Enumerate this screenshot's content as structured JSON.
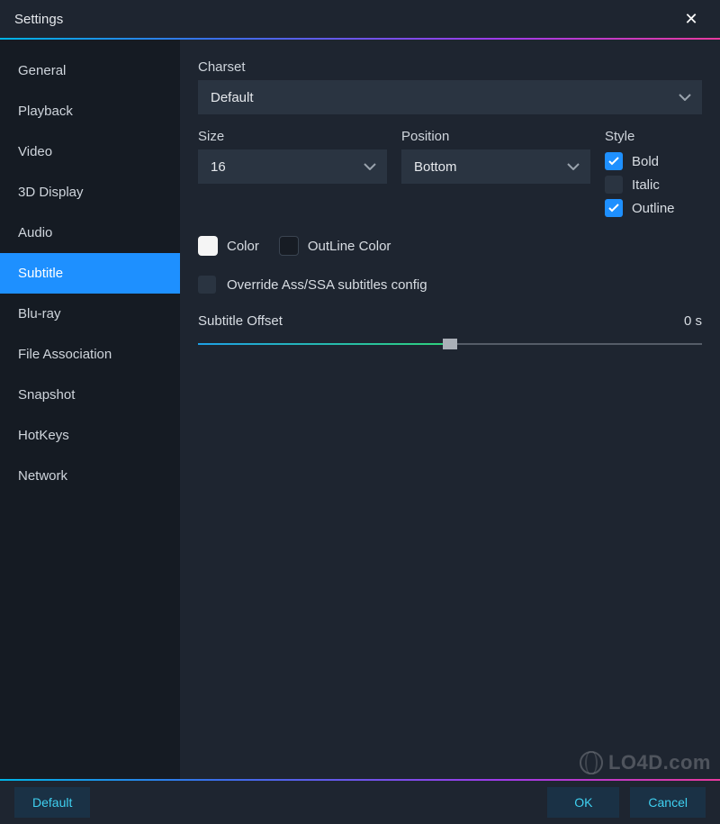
{
  "window": {
    "title": "Settings",
    "close_icon": "✕"
  },
  "sidebar": {
    "items": [
      {
        "label": "General"
      },
      {
        "label": "Playback"
      },
      {
        "label": "Video"
      },
      {
        "label": "3D Display"
      },
      {
        "label": "Audio"
      },
      {
        "label": "Subtitle",
        "active": true
      },
      {
        "label": "Blu-ray"
      },
      {
        "label": "File Association"
      },
      {
        "label": "Snapshot"
      },
      {
        "label": "HotKeys"
      },
      {
        "label": "Network"
      }
    ]
  },
  "panel": {
    "charset": {
      "label": "Charset",
      "value": "Default"
    },
    "size": {
      "label": "Size",
      "value": "16"
    },
    "position": {
      "label": "Position",
      "value": "Bottom"
    },
    "style": {
      "label": "Style",
      "bold_label": "Bold",
      "bold_checked": true,
      "italic_label": "Italic",
      "italic_checked": false,
      "outline_label": "Outline",
      "outline_checked": true
    },
    "color_label": "Color",
    "outline_color_label": "OutLine Color",
    "override_label": "Override Ass/SSA subtitles config",
    "override_checked": false,
    "offset": {
      "label": "Subtitle Offset",
      "value": "0 s",
      "percent": 50
    }
  },
  "footer": {
    "default_label": "Default",
    "ok_label": "OK",
    "cancel_label": "Cancel"
  },
  "watermark": "LO4D.com"
}
